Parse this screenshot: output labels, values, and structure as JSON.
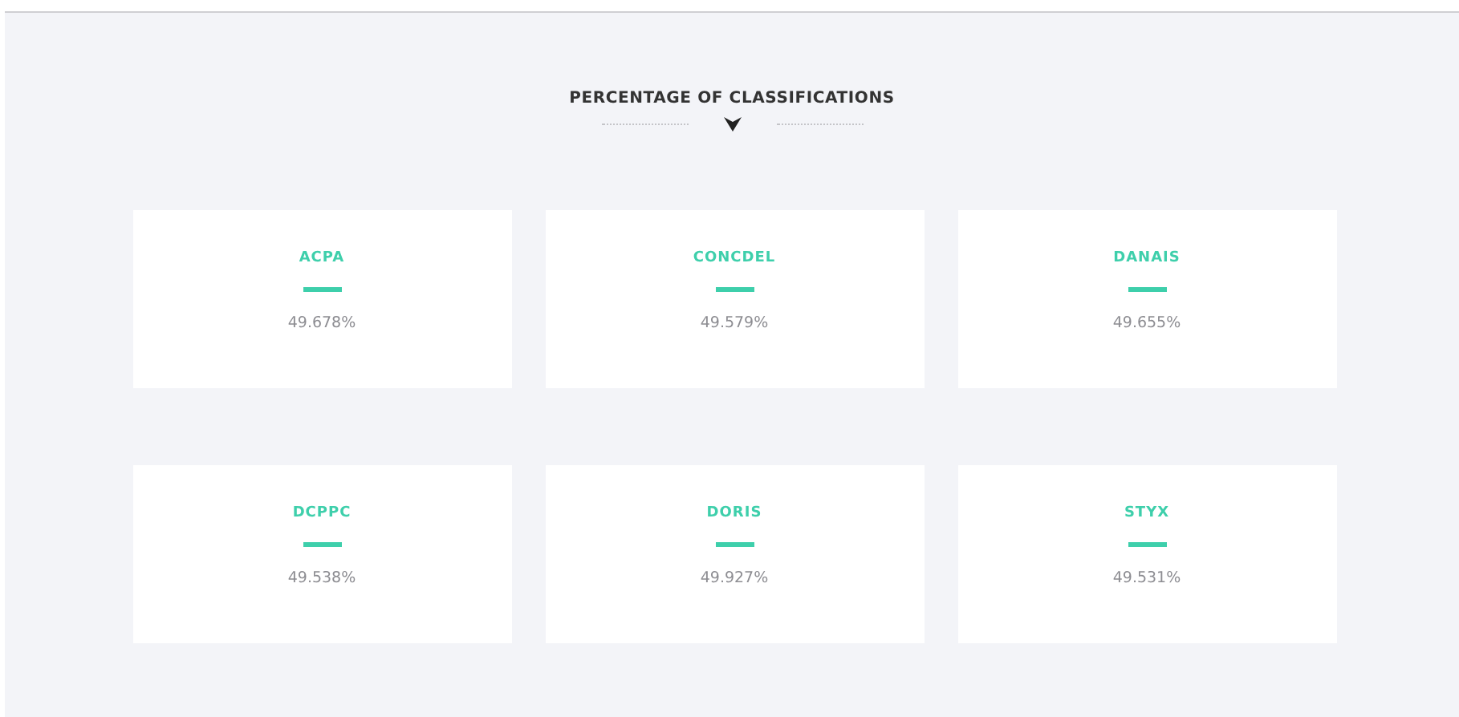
{
  "heading": "PERCENTAGE OF CLASSIFICATIONS",
  "cards": [
    {
      "name": "ACPA",
      "value": "49.678%"
    },
    {
      "name": "CONCDEL",
      "value": "49.579%"
    },
    {
      "name": "DANAIS",
      "value": "49.655%"
    },
    {
      "name": "DCPPC",
      "value": "49.538%"
    },
    {
      "name": "DORIS",
      "value": "49.927%"
    },
    {
      "name": "STYX",
      "value": "49.531%"
    }
  ]
}
